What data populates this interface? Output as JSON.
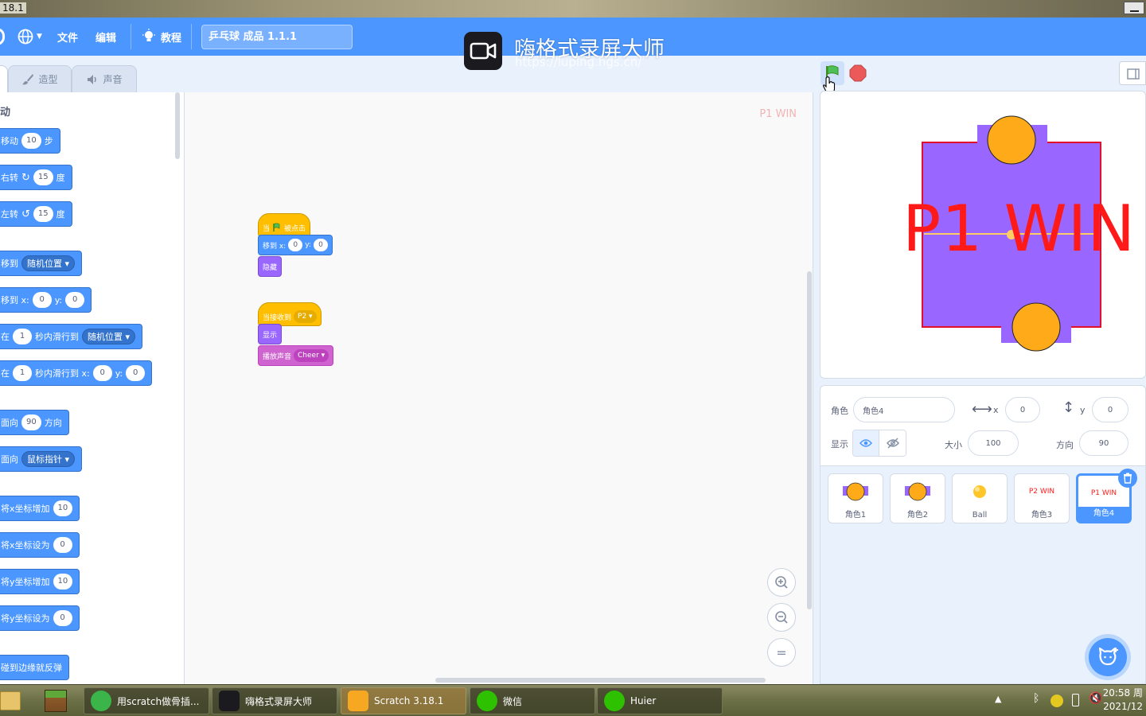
{
  "window": {
    "title_fragment": "18.1"
  },
  "menubar": {
    "file": "文件",
    "edit": "编辑",
    "tutorials": "教程",
    "project_title": "乒乓球 成品 1.1.1"
  },
  "watermark": {
    "title": "嗨格式录屏大师",
    "url": "https://luping.hgs.cn/"
  },
  "tabs": {
    "costumes": "造型",
    "sounds": "声音"
  },
  "palette": {
    "category_title": "动",
    "blocks": [
      {
        "prefix": "移动",
        "v1": "10",
        "suffix": "步"
      },
      {
        "prefix": "右转",
        "v1": "15",
        "suffix": "度"
      },
      {
        "prefix": "左转",
        "v1": "15",
        "suffix": "度"
      },
      {
        "prefix": "移到",
        "drop": "随机位置"
      },
      {
        "prefix": "移到 x:",
        "v1": "0",
        "mid": "y:",
        "v2": "0"
      },
      {
        "prefix": "在",
        "v1": "1",
        "mid": "秒内滑行到",
        "drop": "随机位置"
      },
      {
        "prefix": "在",
        "v1": "1",
        "mid": "秒内滑行到 x:",
        "v2": "0",
        "mid2": "y:",
        "v3": "0"
      },
      {
        "prefix": "面向",
        "v1": "90",
        "suffix": "方向"
      },
      {
        "prefix": "面向",
        "drop": "鼠标指针"
      },
      {
        "prefix": "将x坐标增加",
        "v1": "10"
      },
      {
        "prefix": "将x坐标设为",
        "v1": "0"
      },
      {
        "prefix": "将y坐标增加",
        "v1": "10"
      },
      {
        "prefix": "将y坐标设为",
        "v1": "0"
      },
      {
        "prefix": "碰到边缘就反弹"
      }
    ]
  },
  "code": {
    "sprite_ghost": "P1 WIN",
    "script1": {
      "hat_prefix": "当",
      "hat_suffix": "被点击",
      "goto_label": "移到 x:",
      "goto_x": "0",
      "goto_y_label": "y:",
      "goto_y": "0",
      "hide": "隐藏"
    },
    "script2": {
      "hat_label": "当接收到",
      "hat_msg": "P2",
      "show": "显示",
      "sound_label": "播放声音",
      "sound_name": "Cheer"
    },
    "zoom_in": "+",
    "zoom_out": "−",
    "zoom_reset": "="
  },
  "stage": {
    "text": "P1 WIN",
    "colors": {
      "field": "#9966ff",
      "border": "#e0102a",
      "paddle": "#ffab19",
      "text": "#ff1a1a"
    }
  },
  "sprite_info": {
    "sprite_label": "角色",
    "sprite_name": "角色4",
    "x_label": "x",
    "x_value": "0",
    "y_label": "y",
    "y_value": "0",
    "show_label": "显示",
    "size_label": "大小",
    "size_value": "100",
    "direction_label": "方向",
    "direction_value": "90"
  },
  "sprites": [
    {
      "name": "角色1",
      "thumb": "paddle"
    },
    {
      "name": "角色2",
      "thumb": "paddle"
    },
    {
      "name": "Ball",
      "thumb": "ball"
    },
    {
      "name": "角色3",
      "thumb": "text",
      "thumb_text": "P2 WIN"
    },
    {
      "name": "角色4",
      "thumb": "text",
      "thumb_text": "P1 WIN",
      "selected": true
    }
  ],
  "taskbar": {
    "items": [
      {
        "label": "用scratch做骨插..."
      },
      {
        "label": "嗨格式录屏大师"
      },
      {
        "label": "Scratch 3.18.1"
      },
      {
        "label": "微信"
      },
      {
        "label": "Huier"
      }
    ],
    "clock_time": "20:58 周",
    "clock_date": "2021/12"
  }
}
